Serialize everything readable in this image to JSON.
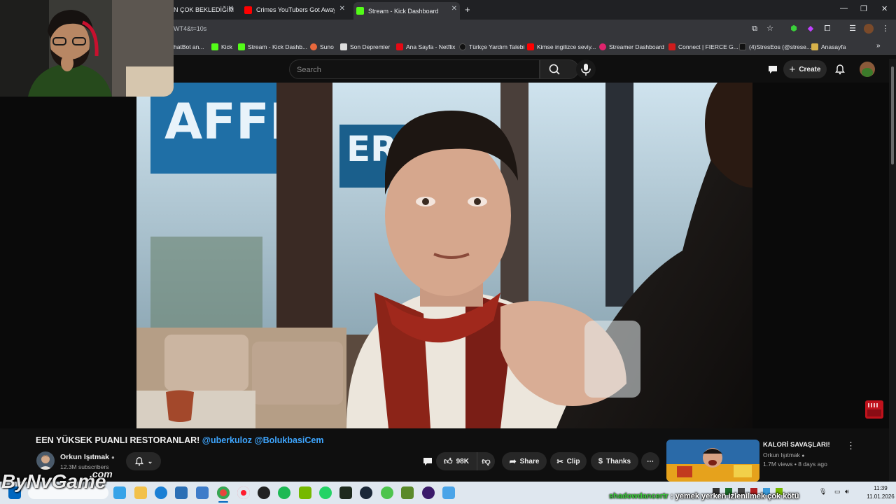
{
  "browser": {
    "tabs": [
      {
        "title": "N ÇOK BEKLEDİĞİM",
        "favicon_color": "#202124"
      },
      {
        "title": "Crimes YouTubers Got Away W",
        "favicon_color": "#ff0000"
      },
      {
        "title": "Stream - Kick Dashboard",
        "favicon_color": "#53fc18"
      }
    ],
    "new_tab_icon": "plus-icon",
    "url": "WT4&t=10s",
    "bookmarks": [
      {
        "label": "hatBot an...",
        "color": "#888888"
      },
      {
        "label": "Kick",
        "color": "#53fc18"
      },
      {
        "label": "Stream - Kick Dashb...",
        "color": "#53fc18"
      },
      {
        "label": "Suno",
        "color": "#e8683c"
      },
      {
        "label": "Son Depremler",
        "color": "#dddddd"
      },
      {
        "label": "Ana Sayfa - Netflix",
        "color": "#e50914"
      },
      {
        "label": "Türkçe Yardım Talebi",
        "color": "#111111"
      },
      {
        "label": "Kimse ingilizce seviy...",
        "color": "#ff0000"
      },
      {
        "label": "Streamer Dashboard",
        "color": "#e0246d"
      },
      {
        "label": "Connect | FIERCE G...",
        "color": "#d01c1c"
      },
      {
        "label": "(4)StresEos (@strese...",
        "color": "#111111"
      },
      {
        "label": "Anasayfa",
        "color": "#d6b14a"
      }
    ]
  },
  "youtube": {
    "search": {
      "placeholder": "Search"
    },
    "create_label": "Create"
  },
  "video": {
    "title_plain": "EEN YÜKSEK PUANLI RESTORANLAR! ",
    "title_mentions": "@uberkuloz @BolukbasiCem",
    "channel": "Orkun Işıtmak",
    "subscribers": "12.3M subscribers",
    "likes": "98K",
    "share_label": "Share",
    "clip_label": "Clip",
    "thanks_label": "Thanks"
  },
  "recommended": {
    "title": "KALORİ SAVAŞLARI!",
    "channel": "Orkun Işıtmak",
    "meta": "1.7M views • 8 days ago"
  },
  "overlay": {
    "chat_user": "shadowdancertr",
    "chat_message": " : yemek yerken izlenilmek çok kötü",
    "watermark": "ByNvGame",
    "watermark_suffix": ".com"
  },
  "taskbar": {
    "time": "11:39",
    "date": "11.01.2026"
  }
}
